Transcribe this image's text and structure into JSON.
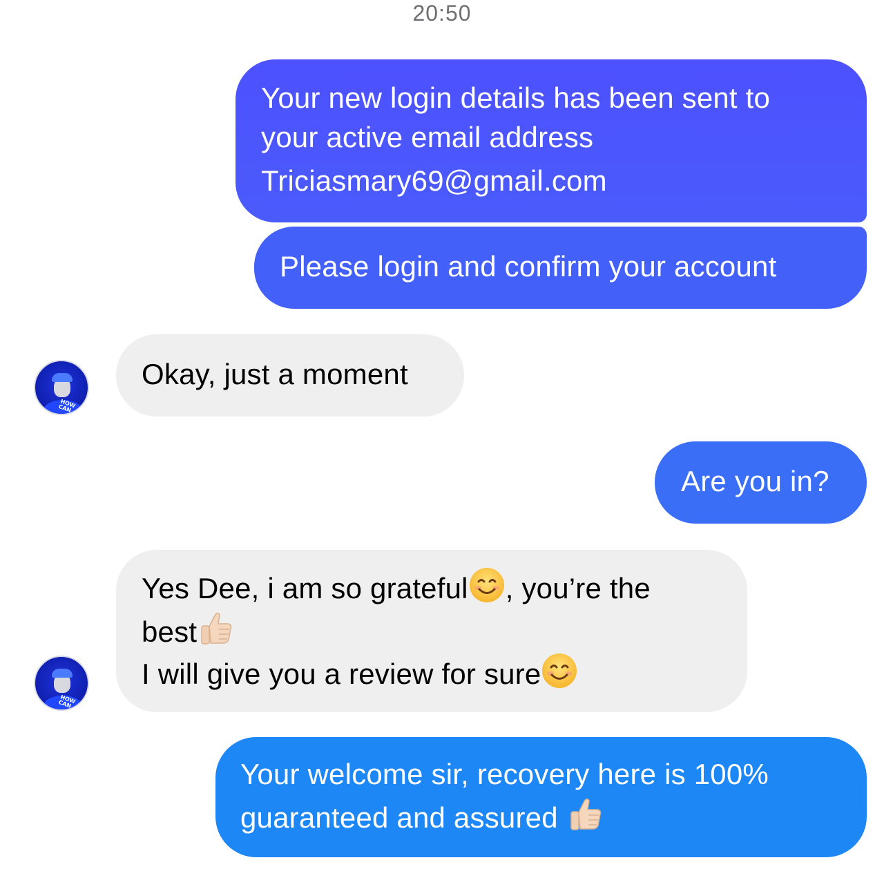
{
  "chat": {
    "timestamp": "20:50",
    "messages": [
      {
        "direction": "outgoing",
        "lines": [
          "Your new login details has been sent to",
          "your active email address",
          "Triciasmary69@gmail.com"
        ]
      },
      {
        "direction": "outgoing",
        "lines": [
          "Please login and confirm your account"
        ]
      },
      {
        "direction": "incoming",
        "lines": [
          "Okay, just a moment"
        ]
      },
      {
        "direction": "outgoing",
        "lines": [
          "Are you in?"
        ]
      },
      {
        "direction": "incoming",
        "segments": {
          "l1a": "Yes Dee, i am so grateful",
          "l1b": ", you’re the",
          "l2": "best",
          "l3": "I will give you a review for sure"
        }
      },
      {
        "direction": "outgoing",
        "lines": [
          "Your welcome sir, recovery here is 100%",
          "guaranteed and assured "
        ]
      }
    ],
    "avatar_badge": "HOW CAN",
    "colors": {
      "outgoing_top": "#4a55ff",
      "outgoing_mid": "#3a6cf7",
      "outgoing_bottom": "#1e87f6",
      "incoming": "#efefef"
    },
    "icons": [
      "smiling-face-emoji",
      "thumbs-up-emoji"
    ]
  }
}
